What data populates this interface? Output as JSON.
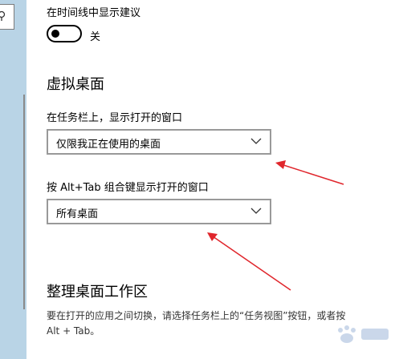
{
  "timeline": {
    "label": "在时间线中显示建议",
    "toggle_state": "关"
  },
  "virtual_desktops": {
    "heading": "虚拟桌面",
    "taskbar_label": "在任务栏上，显示打开的窗口",
    "taskbar_value": "仅限我正在使用的桌面",
    "alttab_label": "按 Alt+Tab 组合键显示打开的窗口",
    "alttab_value": "所有桌面"
  },
  "arrange": {
    "heading": "整理桌面工作区",
    "desc_line1": "要在打开的应用之间切换，请选择任务栏上的“任务视图”按钮，或者按",
    "desc_line2": "Alt + Tab。"
  },
  "annotation": {
    "arrow_color": "#e0262c"
  },
  "icons": {
    "search": "search-icon",
    "chevron": "chevron-down-icon"
  }
}
